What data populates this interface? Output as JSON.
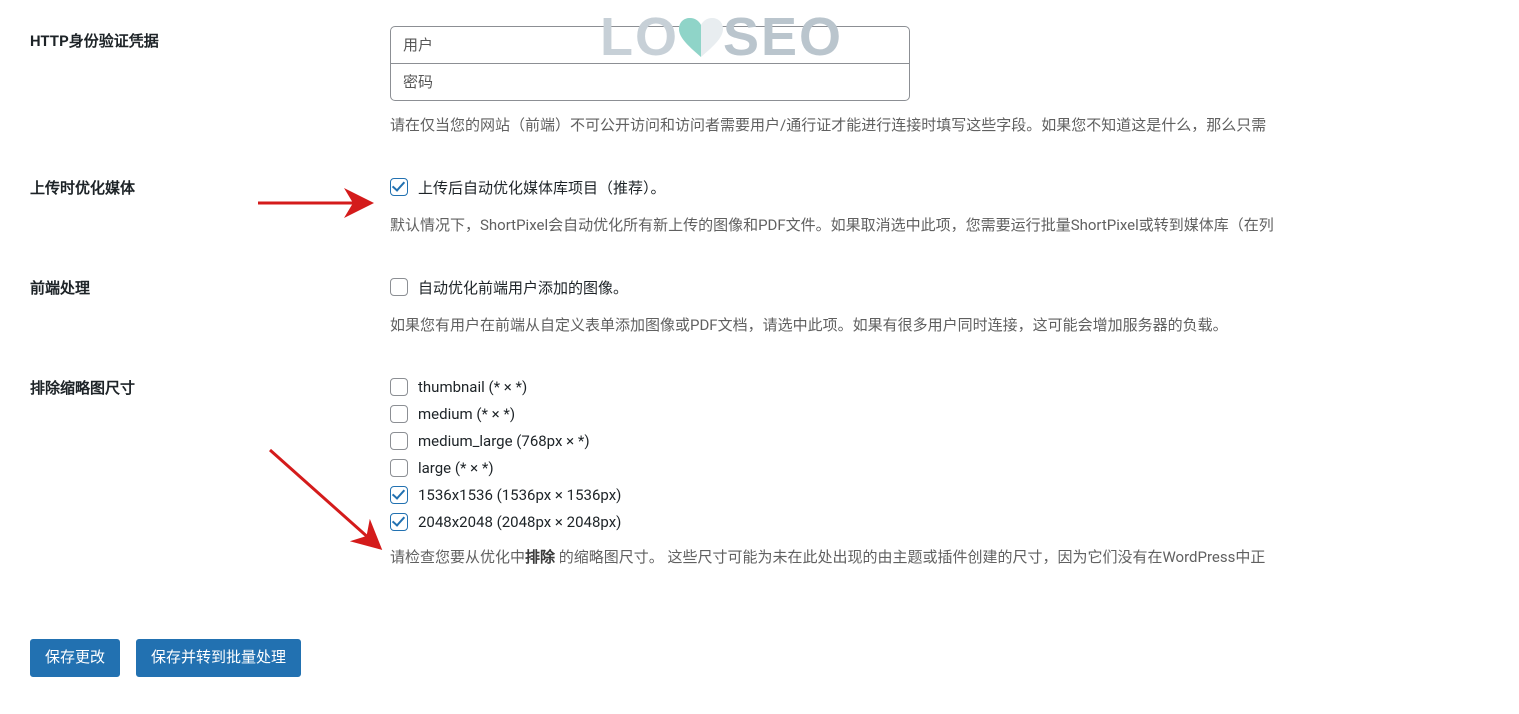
{
  "watermark": {
    "text_lo": "LO",
    "text_seo": "SEO"
  },
  "fields": {
    "http_auth": {
      "label": "HTTP身份验证凭据",
      "user_placeholder": "用户",
      "pass_placeholder": "密码",
      "description": "请在仅当您的网站（前端）不可公开访问和访问者需要用户/通行证才能进行连接时填写这些字段。如果您不知道这是什么，那么只需"
    },
    "optimize_upload": {
      "label": "上传时优化媒体",
      "checkbox_label": "上传后自动优化媒体库项目（推荐）。",
      "description": "默认情况下，ShortPixel会自动优化所有新上传的图像和PDF文件。如果取消选中此项，您需要运行批量ShortPixel或转到媒体库（在列"
    },
    "frontend": {
      "label": "前端处理",
      "checkbox_label": "自动优化前端用户添加的图像。",
      "description": "如果您有用户在前端从自定义表单添加图像或PDF文档，请选中此项。如果有很多用户同时连接，这可能会增加服务器的负载。"
    },
    "exclude_thumbs": {
      "label": "排除缩略图尺寸",
      "sizes": [
        {
          "name": "thumbnail (* × *)",
          "checked": false
        },
        {
          "name": "medium (* × *)",
          "checked": false
        },
        {
          "name": "medium_large (768px × *)",
          "checked": false
        },
        {
          "name": "large (* × *)",
          "checked": false
        },
        {
          "name": "1536x1536 (1536px × 1536px)",
          "checked": true
        },
        {
          "name": "2048x2048 (2048px × 2048px)",
          "checked": true
        }
      ],
      "desc_pre": "请检查您要从优化中",
      "desc_bold": "排除",
      "desc_post": " 的缩略图尺寸。 这些尺寸可能为未在此处出现的由主题或插件创建的尺寸，因为它们没有在WordPress中正"
    }
  },
  "buttons": {
    "save": "保存更改",
    "save_bulk": "保存并转到批量处理"
  }
}
